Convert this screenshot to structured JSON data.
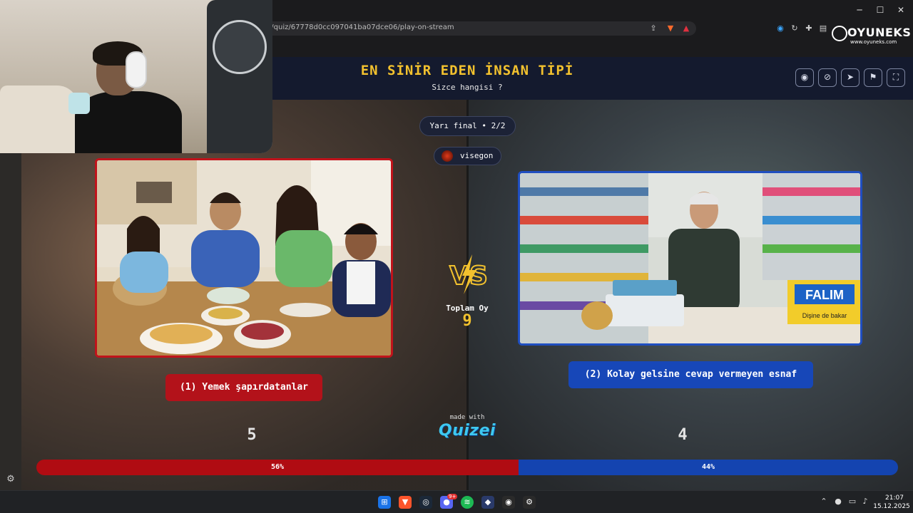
{
  "browser": {
    "url": "nt/quiz/67778d0cc097041ba07dce06/play-on-stream",
    "window_controls": {
      "minimize": "─",
      "maximize": "☐",
      "close": "✕"
    }
  },
  "overlay": {
    "brand_name": "OYUNEKS",
    "brand_url": "www.oyuneks.com"
  },
  "quiz": {
    "title": "EN SİNİR EDEN İNSAN TİPİ",
    "subtitle": "Sizce hangisi ?",
    "round": "Yarı final • 2/2",
    "user": "visegon",
    "vs": "VS",
    "total_votes_label": "Toplam Oy",
    "total_votes": "9",
    "made_with": "made with",
    "brand": "Quizei",
    "options": [
      {
        "label": "(1) Yemek şapırdatanlar",
        "votes": "5",
        "percent_label": "56%",
        "percent": 56,
        "color": "#b00c12"
      },
      {
        "label": "(2) Kolay gelsine cevap vermeyen esnaf",
        "votes": "4",
        "percent_label": "44%",
        "percent": 44,
        "color": "#1444b0"
      }
    ],
    "header_buttons": [
      "eye-icon",
      "link-icon",
      "send-icon",
      "flag-icon",
      "fullscreen-icon"
    ]
  },
  "scene_text": {
    "shop_sign": "FALIM",
    "shop_sign_sub": "Dişine de bakar"
  },
  "taskbar": {
    "time": "21:07",
    "date": "15.12.2025",
    "discord_badge": "9+"
  }
}
